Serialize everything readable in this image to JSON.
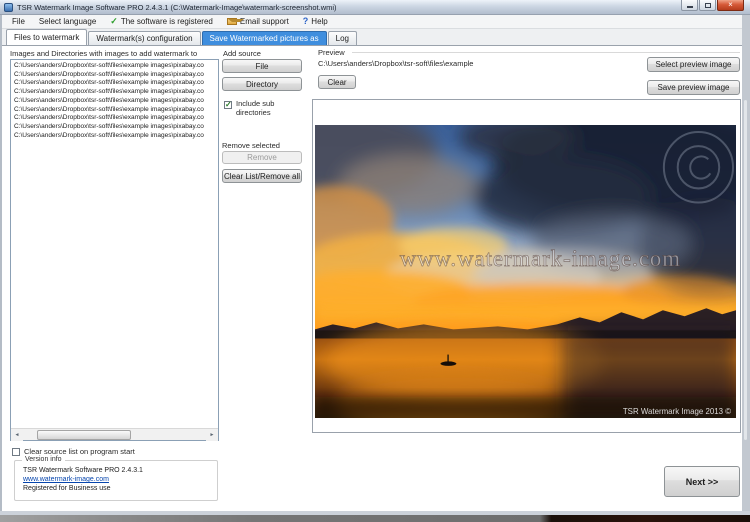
{
  "window": {
    "title": "TSR Watermark Image Software PRO 2.4.3.1 (C:\\Watermark-Image\\watermark-screenshot.wmi)",
    "controls": {
      "close_glyph": "×"
    }
  },
  "menu": {
    "file": "File",
    "select_language": "Select language",
    "registered": "The software is registered",
    "registered_glyph": "✓",
    "email_support": "Email support",
    "help": "Help",
    "help_glyph": "?"
  },
  "tabs": {
    "files": "Files to watermark",
    "config": "Watermark(s) configuration",
    "save": "Save Watermarked pictures as",
    "log": "Log"
  },
  "file_panel": {
    "list_label": "Images and Directories with images to add watermark to",
    "paths": [
      "C:\\Users\\anders\\Dropbox\\tsr-soft\\files\\example images\\pixabay.co",
      "C:\\Users\\anders\\Dropbox\\tsr-soft\\files\\example images\\pixabay.co",
      "C:\\Users\\anders\\Dropbox\\tsr-soft\\files\\example images\\pixabay.co",
      "C:\\Users\\anders\\Dropbox\\tsr-soft\\files\\example images\\pixabay.co",
      "C:\\Users\\anders\\Dropbox\\tsr-soft\\files\\example images\\pixabay.co",
      "C:\\Users\\anders\\Dropbox\\tsr-soft\\files\\example images\\pixabay.co",
      "C:\\Users\\anders\\Dropbox\\tsr-soft\\files\\example images\\pixabay.co",
      "C:\\Users\\anders\\Dropbox\\tsr-soft\\files\\example images\\pixabay.co",
      "C:\\Users\\anders\\Dropbox\\tsr-soft\\files\\example images\\pixabay.co"
    ],
    "add_source_label": "Add source",
    "file_button": "File",
    "directory_button": "Directory",
    "include_sub_label": "Include sub directories",
    "include_sub_checked": true,
    "remove_selected_label": "Remove selected",
    "remove_button": "Remove",
    "clear_list_button": "Clear List/Remove all",
    "clear_on_start_label": "Clear source list on program start",
    "clear_on_start_checked": false
  },
  "version_info": {
    "group_label": "Version info",
    "product": "TSR Watermark Software PRO 2.4.3.1",
    "link": "www.watermark-image.com",
    "license": "Registered for Business use"
  },
  "preview": {
    "group_label": "Preview",
    "path": "C:\\Users\\anders\\Dropbox\\tsr-soft\\files\\example",
    "clear_button": "Clear",
    "select_button": "Select preview image",
    "save_button": "Save preview image",
    "image": {
      "watermark_text": "www.watermark-image.com",
      "corner_text": "TSR Watermark Image 2013 ©"
    }
  },
  "footer": {
    "next_button": "Next >>"
  },
  "colors": {
    "tab_highlight_blue": "#3f8ede",
    "close_button_red": "#b53c1d",
    "link_blue": "#0645ad",
    "check_green": "#2e9e2e"
  }
}
